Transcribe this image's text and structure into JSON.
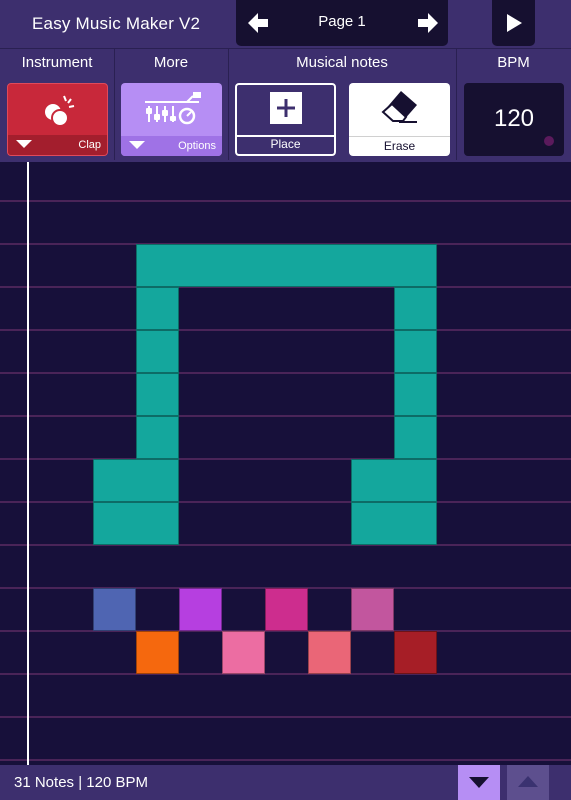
{
  "header": {
    "title": "Easy Music Maker V2",
    "page_label": "Page 1"
  },
  "sections": {
    "instrument": "Instrument",
    "more": "More",
    "notes": "Musical notes",
    "bpm": "BPM"
  },
  "controls": {
    "instrument_label": "Clap",
    "more_label": "Options",
    "place_label": "Place",
    "erase_label": "Erase",
    "bpm_value": "120"
  },
  "footer": {
    "status": "31 Notes | 120 BPM"
  },
  "colors": {
    "teal": "#14a79d",
    "blue": "#4f65b2",
    "purple": "#b63fe0",
    "magenta": "#cd2d8e",
    "pink": "#c2569e",
    "orange": "#f5680e",
    "rose": "#ec6da2",
    "coral": "#ea6677",
    "crimson": "#a61e26"
  },
  "notes": [
    {
      "row": 2,
      "col": 3,
      "len": 7,
      "color": "teal"
    },
    {
      "row": 3,
      "col": 3,
      "len": 1,
      "color": "teal"
    },
    {
      "row": 3,
      "col": 9,
      "len": 1,
      "color": "teal"
    },
    {
      "row": 4,
      "col": 3,
      "len": 1,
      "color": "teal"
    },
    {
      "row": 4,
      "col": 9,
      "len": 1,
      "color": "teal"
    },
    {
      "row": 5,
      "col": 3,
      "len": 1,
      "color": "teal"
    },
    {
      "row": 5,
      "col": 9,
      "len": 1,
      "color": "teal"
    },
    {
      "row": 6,
      "col": 3,
      "len": 1,
      "color": "teal"
    },
    {
      "row": 6,
      "col": 9,
      "len": 1,
      "color": "teal"
    },
    {
      "row": 7,
      "col": 2,
      "len": 2,
      "color": "teal"
    },
    {
      "row": 7,
      "col": 8,
      "len": 2,
      "color": "teal"
    },
    {
      "row": 8,
      "col": 2,
      "len": 2,
      "color": "teal"
    },
    {
      "row": 8,
      "col": 8,
      "len": 2,
      "color": "teal"
    },
    {
      "row": 10,
      "col": 2,
      "len": 1,
      "color": "blue"
    },
    {
      "row": 10,
      "col": 4,
      "len": 1,
      "color": "purple"
    },
    {
      "row": 10,
      "col": 6,
      "len": 1,
      "color": "magenta"
    },
    {
      "row": 10,
      "col": 8,
      "len": 1,
      "color": "pink"
    },
    {
      "row": 11,
      "col": 3,
      "len": 1,
      "color": "orange"
    },
    {
      "row": 11,
      "col": 5,
      "len": 1,
      "color": "rose"
    },
    {
      "row": 11,
      "col": 7,
      "len": 1,
      "color": "coral"
    },
    {
      "row": 11,
      "col": 9,
      "len": 1,
      "color": "crimson"
    }
  ]
}
